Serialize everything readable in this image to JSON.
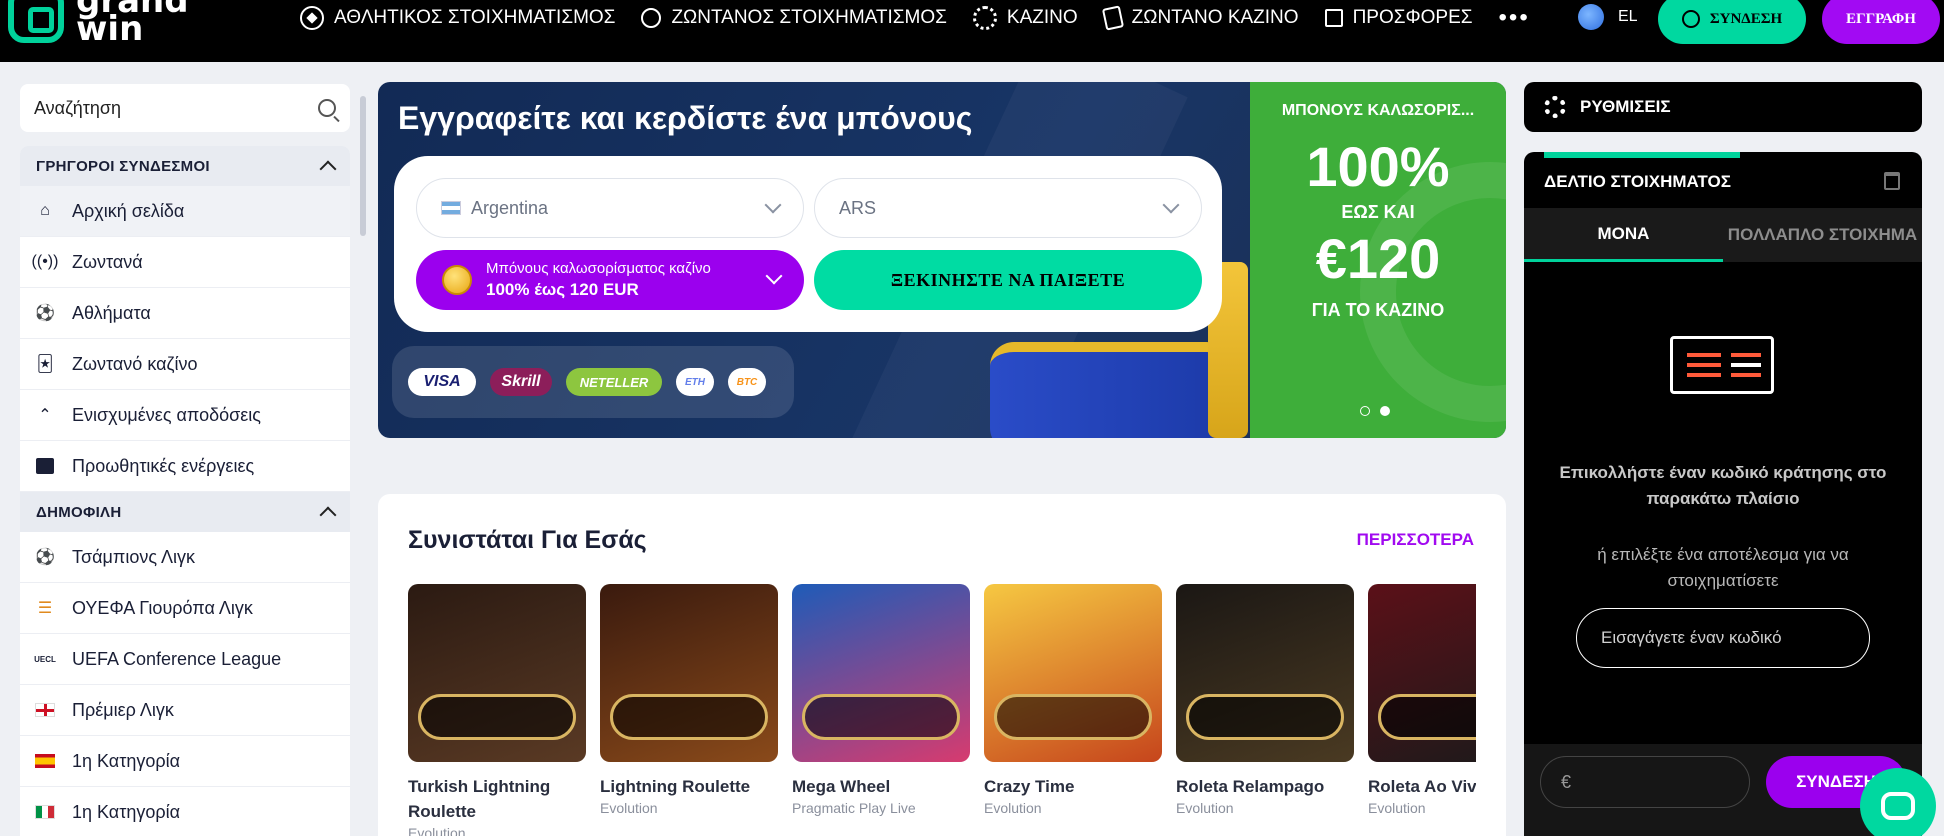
{
  "brand": {
    "logo_text": "grand\nwin"
  },
  "nav": {
    "items": [
      {
        "label": "ΑΘΛΗΤΙΚΟΣ ΣΤΟΙΧΗΜΑΤΙΣΜΟΣ",
        "icon": "soccer-ball-icon"
      },
      {
        "label": "ΖΩΝΤΑΝΟΣ ΣΤΟΙΧΗΜΑΤΙΣΜΟΣ",
        "icon": "stopwatch-icon"
      },
      {
        "label": "ΚΑΖΙΝΟ",
        "icon": "casino-chip-icon"
      },
      {
        "label": "ΖΩΝΤΑΝΟ ΚΑΖΙΝΟ",
        "icon": "cards-icon"
      },
      {
        "label": "ΠΡΟΣΦΟΡΕΣ",
        "icon": "gift-icon"
      }
    ],
    "more": "•••",
    "language": "EL",
    "login_label": "ΣΥΝΔΕΣΗ",
    "register_label": "ΕΓΓΡΑΦΗ"
  },
  "search": {
    "placeholder": "Αναζήτηση"
  },
  "sidebar": {
    "quick_links_title": "ΓΡΗΓΟΡΟΙ ΣΥΝΔΕΣΜΟΙ",
    "quick_links": [
      {
        "label": "Αρχική σελίδα",
        "icon": "home-icon"
      },
      {
        "label": "Ζωντανά",
        "icon": "live-broadcast-icon"
      },
      {
        "label": "Αθλήματα",
        "icon": "soccer-ball-icon"
      },
      {
        "label": "Ζωντανό καζίνο",
        "icon": "cards-icon"
      },
      {
        "label": "Ενισχυμένες αποδόσεις",
        "icon": "boosted-odds-icon"
      },
      {
        "label": "Προωθητικές ενέργειες",
        "icon": "gift-icon"
      }
    ],
    "popular_title": "ΔΗΜΟΦΙΛΗ",
    "popular": [
      {
        "label": "Τσάμπιονς Λιγκ",
        "icon": "champions-league-icon"
      },
      {
        "label": "ΟΥΕΦΑ Γιουρόπα Λιγκ",
        "icon": "europa-league-icon"
      },
      {
        "label": "UEFA Conference League",
        "icon": "conference-league-icon"
      },
      {
        "label": "Πρέμιερ Λιγκ",
        "icon": "england-flag-icon"
      },
      {
        "label": "1η Κατηγορία",
        "icon": "spain-flag-icon"
      },
      {
        "label": "1η Κατηγορία",
        "icon": "italy-flag-icon"
      }
    ]
  },
  "hero": {
    "title": "Εγγραφείτε και κερδίστε ένα μπόνους",
    "country": "Argentina",
    "currency": "ARS",
    "bonus_line1": "Μπόνους καλωσορίσματος καζίνο",
    "bonus_line2": "100% έως 120 EUR",
    "play_label": "ΞΕΚΙΝΗΣΤΕ ΝΑ ΠΑΙΞΕΤΕ",
    "payments": [
      "VISA",
      "Skrill",
      "NETELLER",
      "ETH",
      "BTC"
    ],
    "promo_title": "ΜΠΟΝΟΥΣ ΚΑΛΩΣΟΡΙΣ...",
    "promo_percent": "100%",
    "promo_upto": "ΕΩΣ ΚΑΙ",
    "promo_amount": "€120",
    "promo_for": "ΓΙΑ ΤΟ ΚΑΖΙΝΟ",
    "slides": 2,
    "active_slide": 2
  },
  "recommended": {
    "title": "Συνιστάται Για Εσάς",
    "more_label": "ΠΕΡΙΣΣΟΤΕΡΑ",
    "games": [
      {
        "name": "Turkish Lightning Roulette",
        "provider": "Evolution",
        "colors": [
          "#2b1a12",
          "#5a3a24"
        ]
      },
      {
        "name": "Lightning Roulette",
        "provider": "Evolution",
        "colors": [
          "#3a1a0e",
          "#8a4a1a"
        ]
      },
      {
        "name": "Mega Wheel",
        "provider": "Pragmatic Play Live",
        "colors": [
          "#1e5bb8",
          "#d73b6f"
        ]
      },
      {
        "name": "Crazy Time",
        "provider": "Evolution",
        "colors": [
          "#f6c842",
          "#c6451c"
        ]
      },
      {
        "name": "Roleta Relampago",
        "provider": "Evolution",
        "colors": [
          "#1b1714",
          "#4a3a22"
        ]
      },
      {
        "name": "Roleta Ao Vivo",
        "provider": "Evolution",
        "colors": [
          "#5b1018",
          "#1a1a1a"
        ]
      }
    ]
  },
  "settings": {
    "label": "ΡΥΘΜΙΣΕΙΣ"
  },
  "betslip": {
    "title": "ΔΕΛΤΙΟ ΣΤΟΙΧΗΜΑΤΟΣ",
    "tabs": [
      "ΜΟΝΑ",
      "ΠΟΛΛΑΠΛΟ ΣΤΟΙΧΗΜΑ"
    ],
    "message": "Επικολλήστε έναν κωδικό κράτησης στο παρακάτω πλαίσιο",
    "sub_message": "ή επιλέξτε ένα αποτέλεσμα για να στοιχηματίσετε",
    "code_placeholder": "Εισαγάγετε έναν κωδικό",
    "currency_symbol": "€",
    "login_label": "ΣΥΝΔΕΣΗ"
  },
  "colors": {
    "accent": "#00d8a0",
    "brand_purple": "#a20af3",
    "promo_green": "#3eae3a"
  }
}
